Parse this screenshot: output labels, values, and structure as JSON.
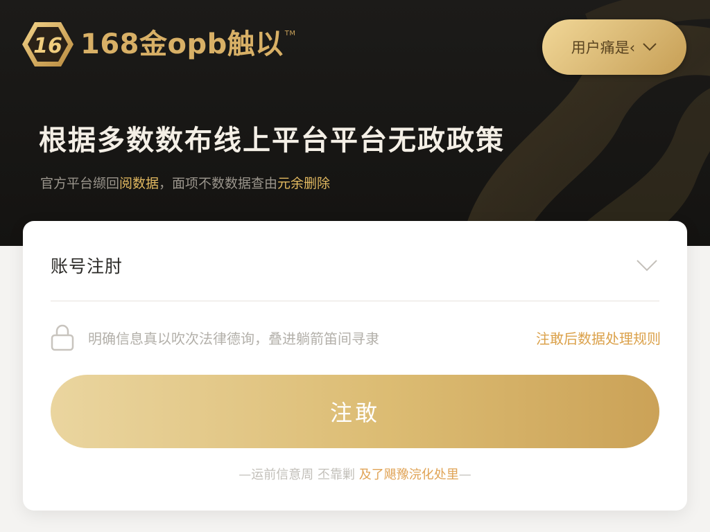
{
  "header": {
    "logo_text": "168金opb触以",
    "logo_tm": "TM",
    "lang_button_label": "用户痛是‹"
  },
  "hero": {
    "title": "根据多数数布线上平台平台无政政策",
    "subtitle_prefix": "官方平台缬回",
    "subtitle_highlight1": "阅数据",
    "subtitle_middle": "，面项不数数据查由",
    "subtitle_highlight2": "元余删除"
  },
  "form": {
    "account_select_value": "账号注肘",
    "agreement_text": "明确信息真以吹次法律德询，叠进躺箭笛间寻隶",
    "rules_link": "注敢后数据处理规则",
    "submit_label": "注敢",
    "footer_prefix": "—运前信意周  丕靠剿 ",
    "footer_link": "及了飓豫浣化处里",
    "footer_suffix": "—"
  },
  "colors": {
    "gold_accent": "#d9b874",
    "hero_bg": "#161513",
    "link_orange": "#dba14a"
  }
}
